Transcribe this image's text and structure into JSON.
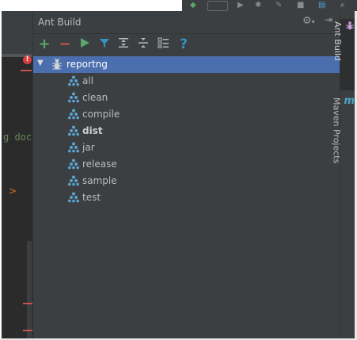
{
  "panel": {
    "title": "Ant Build"
  },
  "toolbar": {
    "add_icon": "plus-icon",
    "remove_icon": "minus-icon",
    "run_icon": "play-icon",
    "filter_icon": "filter-icon",
    "expand_icon": "expand-all-icon",
    "collapse_icon": "collapse-all-icon",
    "properties_icon": "properties-icon",
    "help_label": "?"
  },
  "tree": {
    "root": "reportng",
    "targets": [
      {
        "label": "all",
        "bold": false
      },
      {
        "label": "clean",
        "bold": false
      },
      {
        "label": "compile",
        "bold": false
      },
      {
        "label": "dist",
        "bold": true
      },
      {
        "label": "jar",
        "bold": false
      },
      {
        "label": "release",
        "bold": false
      },
      {
        "label": "sample",
        "bold": false
      },
      {
        "label": "test",
        "bold": false
      }
    ]
  },
  "stripe": {
    "ant_label": "Ant Build",
    "maven_letter": "m",
    "maven_label": "Maven Projects"
  },
  "editor": {
    "code_fragment": "g doc",
    "fold_arrow": ">",
    "error_mark": "!"
  },
  "colors": {
    "selection": "#4b6eaf",
    "panel_bg": "#3c3f41",
    "ant_target_icon": "#5ba3d0",
    "add_green": "#59a869",
    "remove_red": "#c75450",
    "run_green": "#59a869",
    "filter_blue": "#3592c4"
  }
}
